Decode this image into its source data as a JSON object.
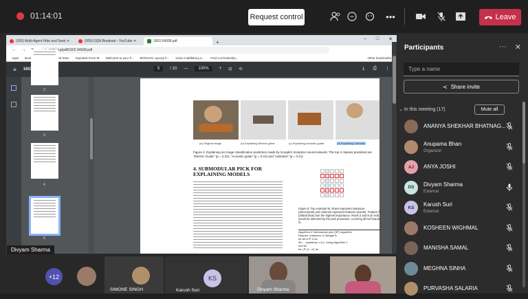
{
  "topbar": {
    "timer": "01:14:01",
    "request_control": "Request control",
    "leave": "Leave",
    "colors": {
      "recording": "#e03a3e",
      "leave_bg": "#c4314b"
    },
    "icons": [
      "people-icon",
      "chat-icon",
      "reactions-icon",
      "more-icon",
      "camera-icon",
      "mic-off-icon",
      "share-tray-icon",
      "phone-icon"
    ]
  },
  "browser": {
    "tabs": [
      {
        "label": "(309) Multi-Agent Hide and Seek ✕"
      },
      {
        "label": "(309) DQN Breakout - YouTube ✕"
      },
      {
        "label": "1602.04938.pdf"
      }
    ],
    "url": "arxiv.org/pdf/1602.04938.pdf",
    "bookmarks": [
      "Apps",
      "Bookmarks",
      "Suggested Sites",
      "Imported From IE",
      "Welcome to your fi...",
      "BitTorrent: ayoorp fi...",
      "vision.middlebury.e...",
      "Find a scholarship...",
      "Other bookmarks"
    ]
  },
  "pdf": {
    "filename": "1602.04938.pdf",
    "page": "5",
    "pages_total": "/ 10",
    "zoom": "100%",
    "thumb_numbers": [
      "3",
      "4",
      "5"
    ],
    "fig_captions": [
      "(a) Original Image",
      "(b) Explaining Electric guitar",
      "(c) Explaining Acoustic guitar",
      "(d) Explaining Labrador"
    ],
    "figure4_caption": "Figure 4: Explaining an image classification prediction made by Google's Inception neural network. The top 3 classes predicted are \"Electric Guitar\" (p = 0.32), \"Acoustic guitar\" (p = 0.24) and \"Labrador\" (p = 0.21)",
    "section_heading": "4. SUBMODULAR PICK FOR EXPLAINING MODELS",
    "figure5_caption": "Figure 5: Toy example W. Rows represent instances (documents) and columns represent features (words). Feature f2 (dotted blue) has the highest importance. Rows 2 and 5 (in red) would be selected by the pick procedure, covering all but feature f1.",
    "algorithm": "Algorithm 2 Submodular pick (SP) algorithm",
    "require": "Require: Instances X, Budget B",
    "algo_lines": [
      "for all xi ∈ X do",
      "Wi ← explain(xi, x'i)      ▷ Using Algorithm 1",
      "end for",
      "for j ∈ {1...d'} do"
    ]
  },
  "video": {
    "presenter_label": "Divyam Sharma",
    "more_count": "+12",
    "tiles": [
      {
        "name": "SIMONE SINGH"
      },
      {
        "name": "Karush Suri",
        "initials": "KS"
      },
      {
        "name": "Divyam Sharma"
      }
    ]
  },
  "participants": {
    "title": "Participants",
    "search_placeholder": "Type a name",
    "share_invite": "Share invite",
    "section": "In this meeting (17)",
    "mute_all": "Mute all",
    "people": [
      {
        "name": "ANANYA SHEKHAR BHATNAG...",
        "role": "",
        "avatar": "photo",
        "color": "#8a6a55",
        "mic": "muted"
      },
      {
        "name": "Anupama Bhan",
        "role": "Organizer",
        "avatar": "photo",
        "color": "#b08a70",
        "mic": "muted"
      },
      {
        "name": "ANYA JOSHI",
        "role": "",
        "initials": "AJ",
        "color": "#e8a0a8",
        "mic": "muted"
      },
      {
        "name": "Divyam Sharma",
        "role": "External",
        "initials": "DS",
        "color": "#c8e6e0",
        "mic": "on"
      },
      {
        "name": "Karush Suri",
        "role": "External",
        "initials": "KS",
        "color": "#c7c3e8",
        "mic": "muted"
      },
      {
        "name": "KOSHEEN WIGHMAL",
        "role": "",
        "avatar": "photo",
        "color": "#9a7b6a",
        "mic": "muted"
      },
      {
        "name": "MANISHA SAMAL",
        "role": "",
        "avatar": "photo",
        "color": "#7a6458",
        "mic": "muted"
      },
      {
        "name": "MEGHNA SINHA",
        "role": "",
        "avatar": "photo",
        "color": "#6d8a99",
        "mic": "muted"
      },
      {
        "name": "PURVASHA SALARIA",
        "role": "",
        "avatar": "photo",
        "color": "#b0906a",
        "mic": "muted"
      }
    ]
  }
}
